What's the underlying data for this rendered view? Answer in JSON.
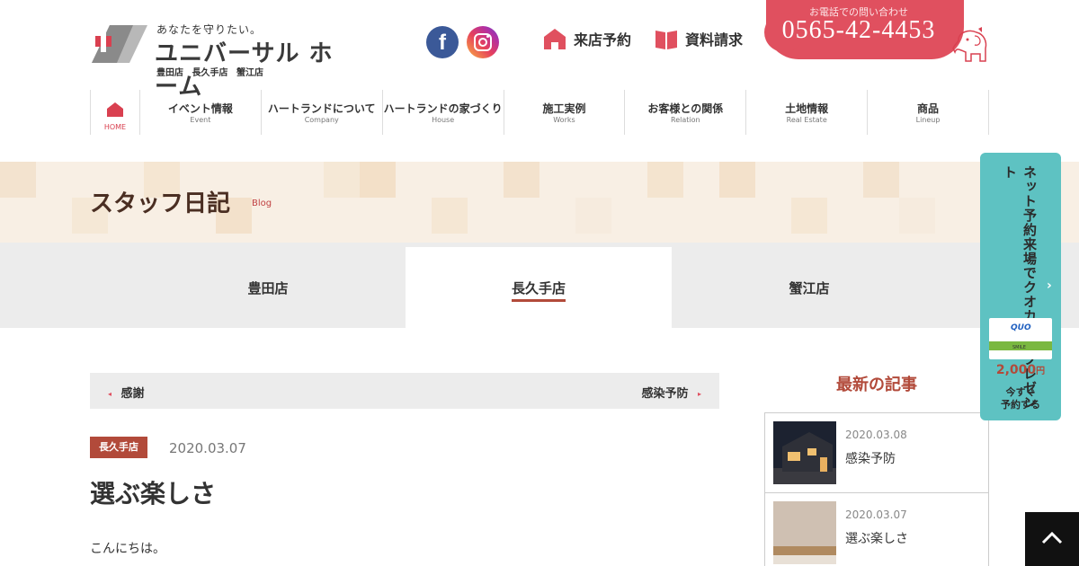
{
  "header": {
    "logo_tagline": "あなたを守りたい。",
    "logo_name": "ユニバーサル ホーム",
    "logo_stores": "豊田店 長久手店 蟹江店",
    "sns": [
      {
        "name": "facebook",
        "glyph": "f"
      },
      {
        "name": "instagram"
      }
    ],
    "visit_label": "来店予約",
    "doc_label": "資料請求",
    "tel_label": "お電話での問い合わせ",
    "tel_number": "0565-42-4453"
  },
  "nav": {
    "home_label": "HOME",
    "items": [
      {
        "ja": "イベント情報",
        "en": "Event"
      },
      {
        "ja": "ハートランドについて",
        "en": "Company"
      },
      {
        "ja": "ハートランドの家づくり",
        "en": "House"
      },
      {
        "ja": "施工実例",
        "en": "Works"
      },
      {
        "ja": "お客様との関係",
        "en": "Relation"
      },
      {
        "ja": "土地情報",
        "en": "Real Estate"
      },
      {
        "ja": "商品",
        "en": "Lineup"
      }
    ]
  },
  "page": {
    "title": "スタッフ日記",
    "title_en": "Blog"
  },
  "store_tabs": [
    {
      "label": "豊田店",
      "active": false
    },
    {
      "label": "長久手店",
      "active": true
    },
    {
      "label": "蟹江店",
      "active": false
    }
  ],
  "pager": {
    "prev": "感謝",
    "next": "感染予防",
    "prev_arrow": "◂",
    "next_arrow": "▸"
  },
  "article": {
    "category": "長久手店",
    "date": "2020.03.07",
    "title": "選ぶ楽しさ",
    "body_first_line": "こんにちは。"
  },
  "sidebar": {
    "heading": "最新の記事",
    "posts": [
      {
        "date": "2020.03.08",
        "title": "感染予防"
      },
      {
        "date": "2020.03.07",
        "title": "選ぶ楽しさ"
      }
    ]
  },
  "campaign": {
    "text": "ネット予約来場でクオカードプレゼント",
    "chevron": "›",
    "card_brand": "QUO",
    "card_sub": "SMILE",
    "amount": "2,000",
    "amount_unit": "円",
    "cta_line1": "今すぐ",
    "cta_line2": "予約する"
  },
  "colors": {
    "accent_red": "#e0505f",
    "brown": "#b24a3a",
    "teal": "#5ec2c2"
  }
}
